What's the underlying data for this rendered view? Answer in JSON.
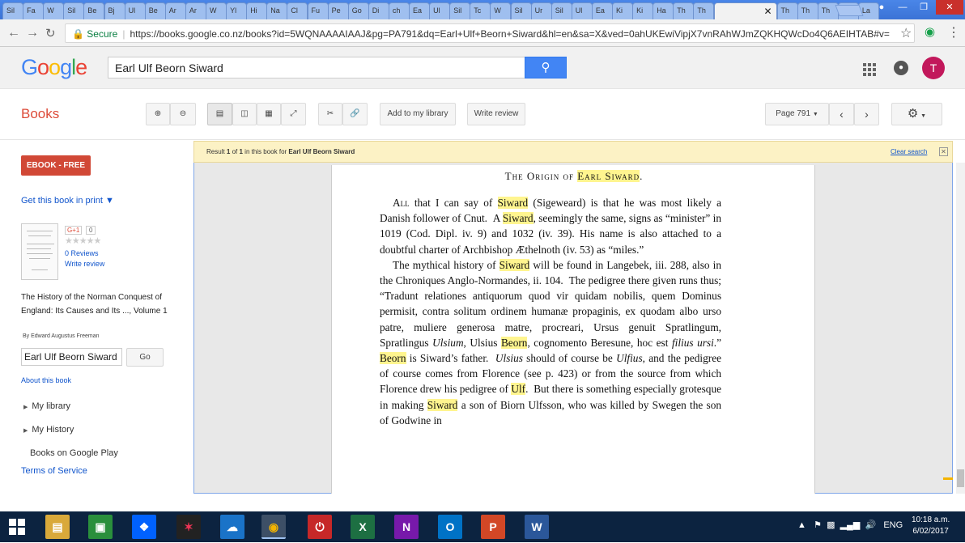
{
  "browser": {
    "tabs": [
      "Sil",
      "Fa",
      "W",
      "Sil",
      "Be",
      "Bj",
      "Ul",
      "Be",
      "Ar",
      "Ar",
      "W",
      "Yl",
      "Hi",
      "Na",
      "Cl",
      "Fu",
      "Pe",
      "Go",
      "Di",
      "ch",
      "Ea",
      "Ul",
      "Sil",
      "Tc",
      "W",
      "Sil",
      "Ur",
      "Sil",
      "Ul",
      "Ea",
      "Ki",
      "Ki",
      "Ha",
      "Th",
      "Th"
    ],
    "active_tab": "",
    "tabs_after": [
      "Th",
      "Th",
      "Th",
      "Th",
      "La"
    ],
    "secure_label": "Secure",
    "url": "https://books.google.co.nz/books?id=5WQNAAAAIAAJ&pg=PA791&dq=Earl+Ulf+Beorn+Siward&hl=en&sa=X&ved=0ahUKEwiVipjX7vnRAhWJmZQKHQWcDo4Q6AEIHTAB#v="
  },
  "google": {
    "logo": "Google",
    "search_value": "Earl Ulf Beorn Siward",
    "avatar_letter": "T"
  },
  "books": {
    "title": "Books",
    "add_library": "Add to my library",
    "write_review": "Write review",
    "page_label": "Page 791"
  },
  "sidebar": {
    "ebook": "EBOOK - FREE",
    "get_print": "Get this book in print ▼",
    "gplus": "G+1",
    "gplus_count": "0",
    "stars": "★★★★★",
    "reviews": "0 Reviews",
    "write_review": "Write review",
    "book_title": "The History of the Norman Conquest of England: Its Causes and Its ..., Volume 1",
    "author": "By Edward Augustus Freeman",
    "search_value": "Earl Ulf Beorn Siward",
    "go": "Go",
    "about": "About this book",
    "my_library": "My library",
    "my_history": "My History",
    "play": "Books on Google Play",
    "terms": "Terms of Service"
  },
  "result": {
    "text_pre": "Result ",
    "num": "1",
    "of": " of ",
    "total": "1",
    "text_mid": " in this book for ",
    "query": "Earl Ulf Beorn Siward",
    "clear": "Clear search"
  },
  "page": {
    "heading_pre": "The Origin of ",
    "heading_hl": "Earl Siward",
    "heading_post": "."
  },
  "taskbar": {
    "lang": "ENG",
    "time": "10:18 a.m.",
    "date": "6/02/2017"
  }
}
